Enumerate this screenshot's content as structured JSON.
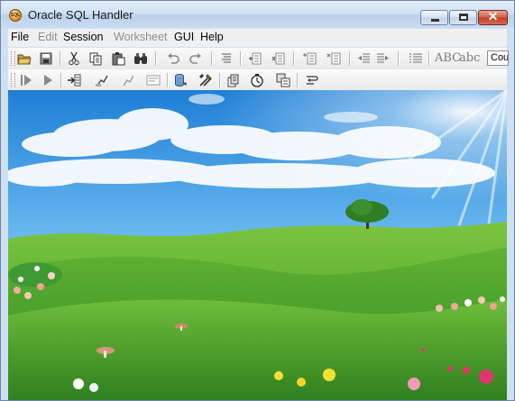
{
  "window": {
    "title": "Oracle SQL Handler",
    "icon": "database-app-icon",
    "icon_text": "SQL"
  },
  "window_controls": {
    "minimize": "minimize-icon",
    "maximize": "maximize-icon",
    "close": "close-icon",
    "close_glyph": "✕"
  },
  "menu": {
    "items": [
      {
        "label": "File",
        "enabled": true
      },
      {
        "label": "Edit",
        "enabled": false
      },
      {
        "label": "Session",
        "enabled": true
      },
      {
        "label": "Worksheet",
        "enabled": false
      },
      {
        "label": "GUI",
        "enabled": true
      },
      {
        "label": "Help",
        "enabled": true
      }
    ]
  },
  "toolbar1": {
    "icons": [
      "open-folder-icon",
      "save-icon",
      "cut-icon",
      "copy-icon",
      "paste-icon",
      "find-icon",
      "undo-icon",
      "redo-icon",
      "indent-block-icon",
      "insert-row-icon",
      "delete-row-icon",
      "add-column-icon",
      "remove-column-icon",
      "outdent-icon",
      "indent-icon",
      "list-icon"
    ],
    "text_buttons": {
      "uppercase": "ABC",
      "lowercase": "abc"
    },
    "font_combo": {
      "value": "Cou"
    }
  },
  "toolbar2": {
    "icons": [
      "run-icon",
      "run-step-icon",
      "execute-script-icon",
      "explain-plan-icon",
      "commit-icon",
      "rollback-icon",
      "database-connect-icon",
      "tools-icon",
      "history-icon",
      "timer-icon",
      "schema-browser-icon",
      "wrap-icon"
    ]
  },
  "desktop": {
    "image": "green-hills-wallpaper",
    "colors": {
      "sky_top": "#1f7fd6",
      "sky_low": "#bfe4fb",
      "grass_light": "#6fbd3a",
      "grass_dark": "#2f8a22"
    }
  }
}
